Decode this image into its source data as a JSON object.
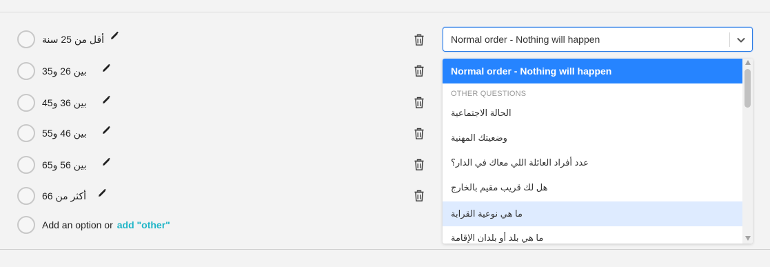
{
  "options": [
    {
      "label": "أقل من 25 سنة"
    },
    {
      "label": "بين 26 و35"
    },
    {
      "label": "بين 36 و45"
    },
    {
      "label": "بين 46 و55"
    },
    {
      "label": "بين 56 و65"
    },
    {
      "label": "أكثر من 66"
    }
  ],
  "add_option": {
    "text": "Add an option or",
    "other_link": "add \"other\""
  },
  "logic_select": {
    "value": "Normal order - Nothing will happen",
    "menu": {
      "selected_label": "Normal order - Nothing will happen",
      "group_label": "OTHER QUESTIONS",
      "items": [
        "الحالة الاجتماعية",
        "وضعيتك المهنية",
        "عدد أفراد العائلة اللي معاك في الدار؟",
        "هل لك قريب مقيم بالخارج",
        "ما هي نوعية القرابة",
        "ما هي بلد أو بلدان الإقامة"
      ],
      "hovered_index": 4
    }
  },
  "icons": {
    "edit": "pencil-icon",
    "delete": "trash-icon",
    "dropdown": "chevron-down-icon",
    "radio": "radio-circle-icon"
  },
  "colors": {
    "accent_blue": "#2684ff",
    "hover_blue": "#deebff",
    "link_teal": "#1fb5c7"
  }
}
